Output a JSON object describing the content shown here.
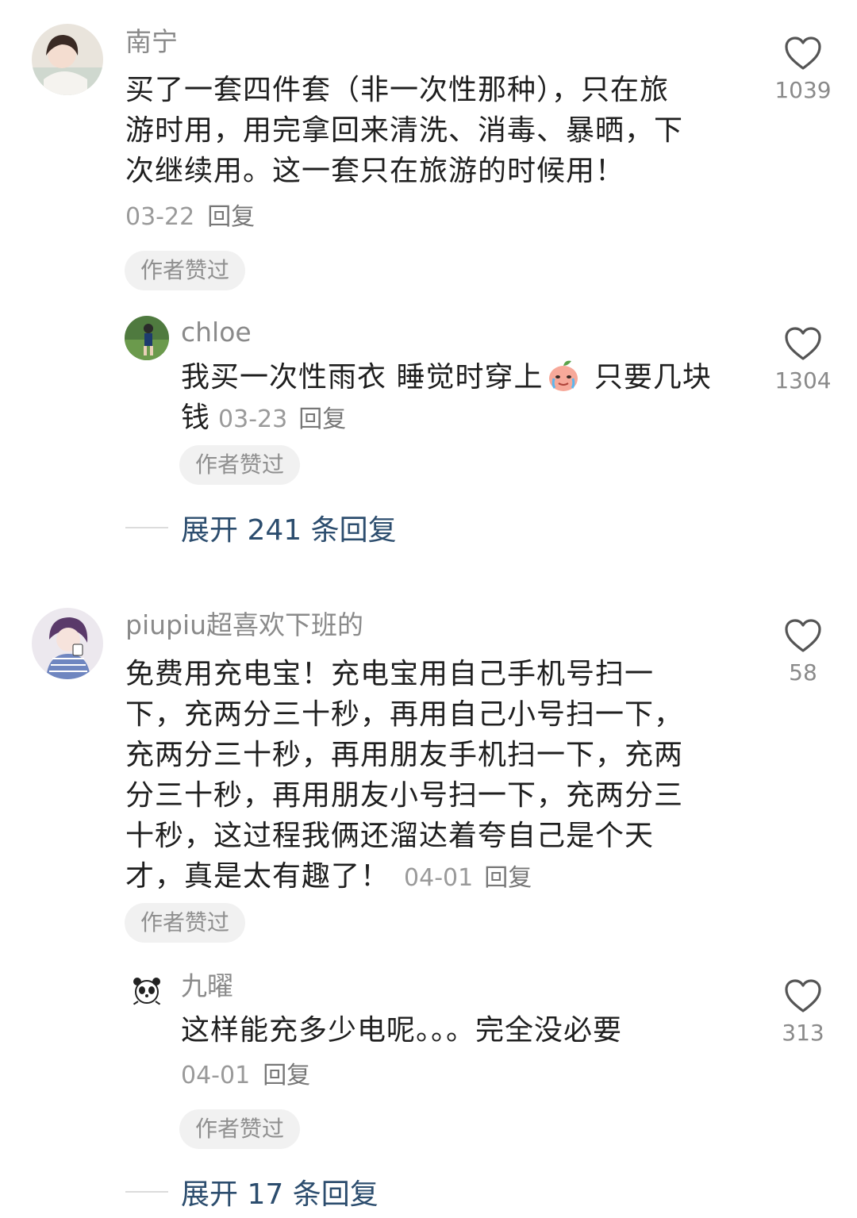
{
  "comments": [
    {
      "username": "南宁",
      "lines": [
        "买了一套四件套（非一次性那种），只在旅",
        "游时用，用完拿回来清洗、消毒、暴晒，下",
        "次继续用。这一套只在旅游的时候用！"
      ],
      "date": "03-22",
      "reply_label": "回复",
      "badge": "作者赞过",
      "likes": "1039",
      "replies": [
        {
          "username": "chloe",
          "text_before_emoji": "我买一次性雨衣 睡觉时穿上",
          "emoji": "crying-peach-emoji",
          "text_after_emoji": " 只要几块",
          "text_line2": "钱",
          "date": "03-23",
          "reply_label": "回复",
          "badge": "作者赞过",
          "likes": "1304"
        }
      ],
      "expand_label": "展开 241 条回复"
    },
    {
      "username": "piupiu超喜欢下班的",
      "lines": [
        "免费用充电宝！充电宝用自己手机号扫一",
        "下，充两分三十秒，再用自己小号扫一下，",
        "充两分三十秒，再用朋友手机扫一下，充两",
        "分三十秒，再用朋友小号扫一下，充两分三",
        "十秒，这过程我俩还溜达着夸自己是个天",
        "才，真是太有趣了！"
      ],
      "date": "04-01",
      "reply_label": "回复",
      "badge": "作者赞过",
      "likes": "58",
      "replies": [
        {
          "username": "九曜",
          "text": "这样能充多少电呢。。。完全没必要",
          "date": "04-01",
          "reply_label": "回复",
          "badge": "作者赞过",
          "likes": "313"
        }
      ],
      "expand_label": "展开 17 条回复"
    }
  ],
  "icons": {
    "like": "heart-outline-icon",
    "color_like": "#555555"
  }
}
